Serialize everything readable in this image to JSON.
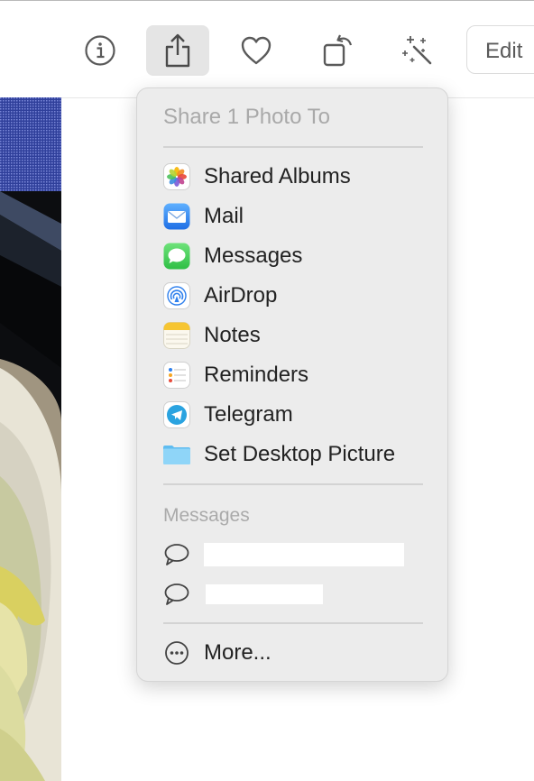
{
  "toolbar": {
    "info_icon": "info-icon",
    "share_icon": "share-icon",
    "favorite_icon": "heart-icon",
    "rotate_icon": "rotate-icon",
    "enhance_icon": "magic-wand-icon",
    "edit_label": "Edit"
  },
  "share_menu": {
    "header": "Share 1 Photo To",
    "items": [
      {
        "label": "Shared Albums",
        "icon": "photos-icon"
      },
      {
        "label": "Mail",
        "icon": "mail-icon"
      },
      {
        "label": "Messages",
        "icon": "messages-icon"
      },
      {
        "label": "AirDrop",
        "icon": "airdrop-icon"
      },
      {
        "label": "Notes",
        "icon": "notes-icon"
      },
      {
        "label": "Reminders",
        "icon": "reminders-icon"
      },
      {
        "label": "Telegram",
        "icon": "telegram-icon"
      },
      {
        "label": "Set Desktop Picture",
        "icon": "desktop-folder-icon"
      }
    ],
    "messages_section_label": "Messages",
    "contacts": [
      {
        "icon": "message-bubble-icon"
      },
      {
        "icon": "message-bubble-icon"
      }
    ],
    "more_label": "More...",
    "more_icon": "ellipsis-circle-icon"
  },
  "colors": {
    "menu_bg": "#ececec",
    "active_button_bg": "#e5e5e5",
    "mail_blue": "#3d8ef0",
    "messages_green": "#4cd964",
    "telegram_blue": "#2aa3e0",
    "folder_blue": "#7dcdf6"
  }
}
